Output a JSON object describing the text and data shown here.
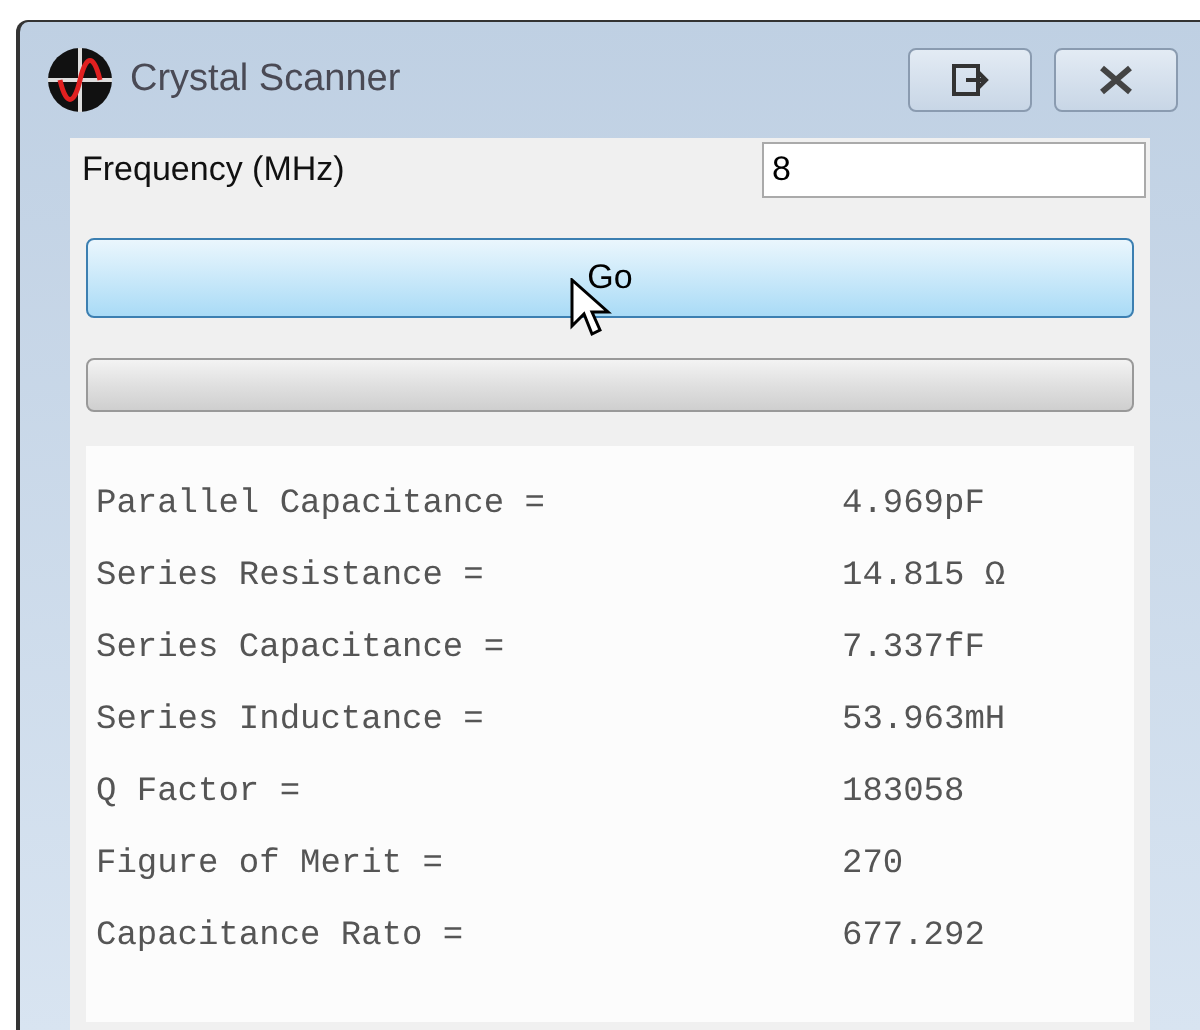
{
  "window": {
    "title": "Crystal Scanner"
  },
  "frequency": {
    "label": "Frequency (MHz)",
    "value": "8"
  },
  "go_button": {
    "label": "Go"
  },
  "progress": {
    "level": 0
  },
  "results": [
    {
      "label": "Parallel Capacitance =",
      "value": "4.969pF"
    },
    {
      "label": "Series Resistance =",
      "value": "14.815 Ω"
    },
    {
      "label": "Series Capacitance =",
      "value": "7.337fF"
    },
    {
      "label": "Series Inductance =",
      "value": "53.963mH"
    },
    {
      "label": "Q Factor =",
      "value": "183058"
    },
    {
      "label": "Figure of Merit =",
      "value": "270"
    },
    {
      "label": "Capacitance Rato =",
      "value": "677.292"
    }
  ]
}
